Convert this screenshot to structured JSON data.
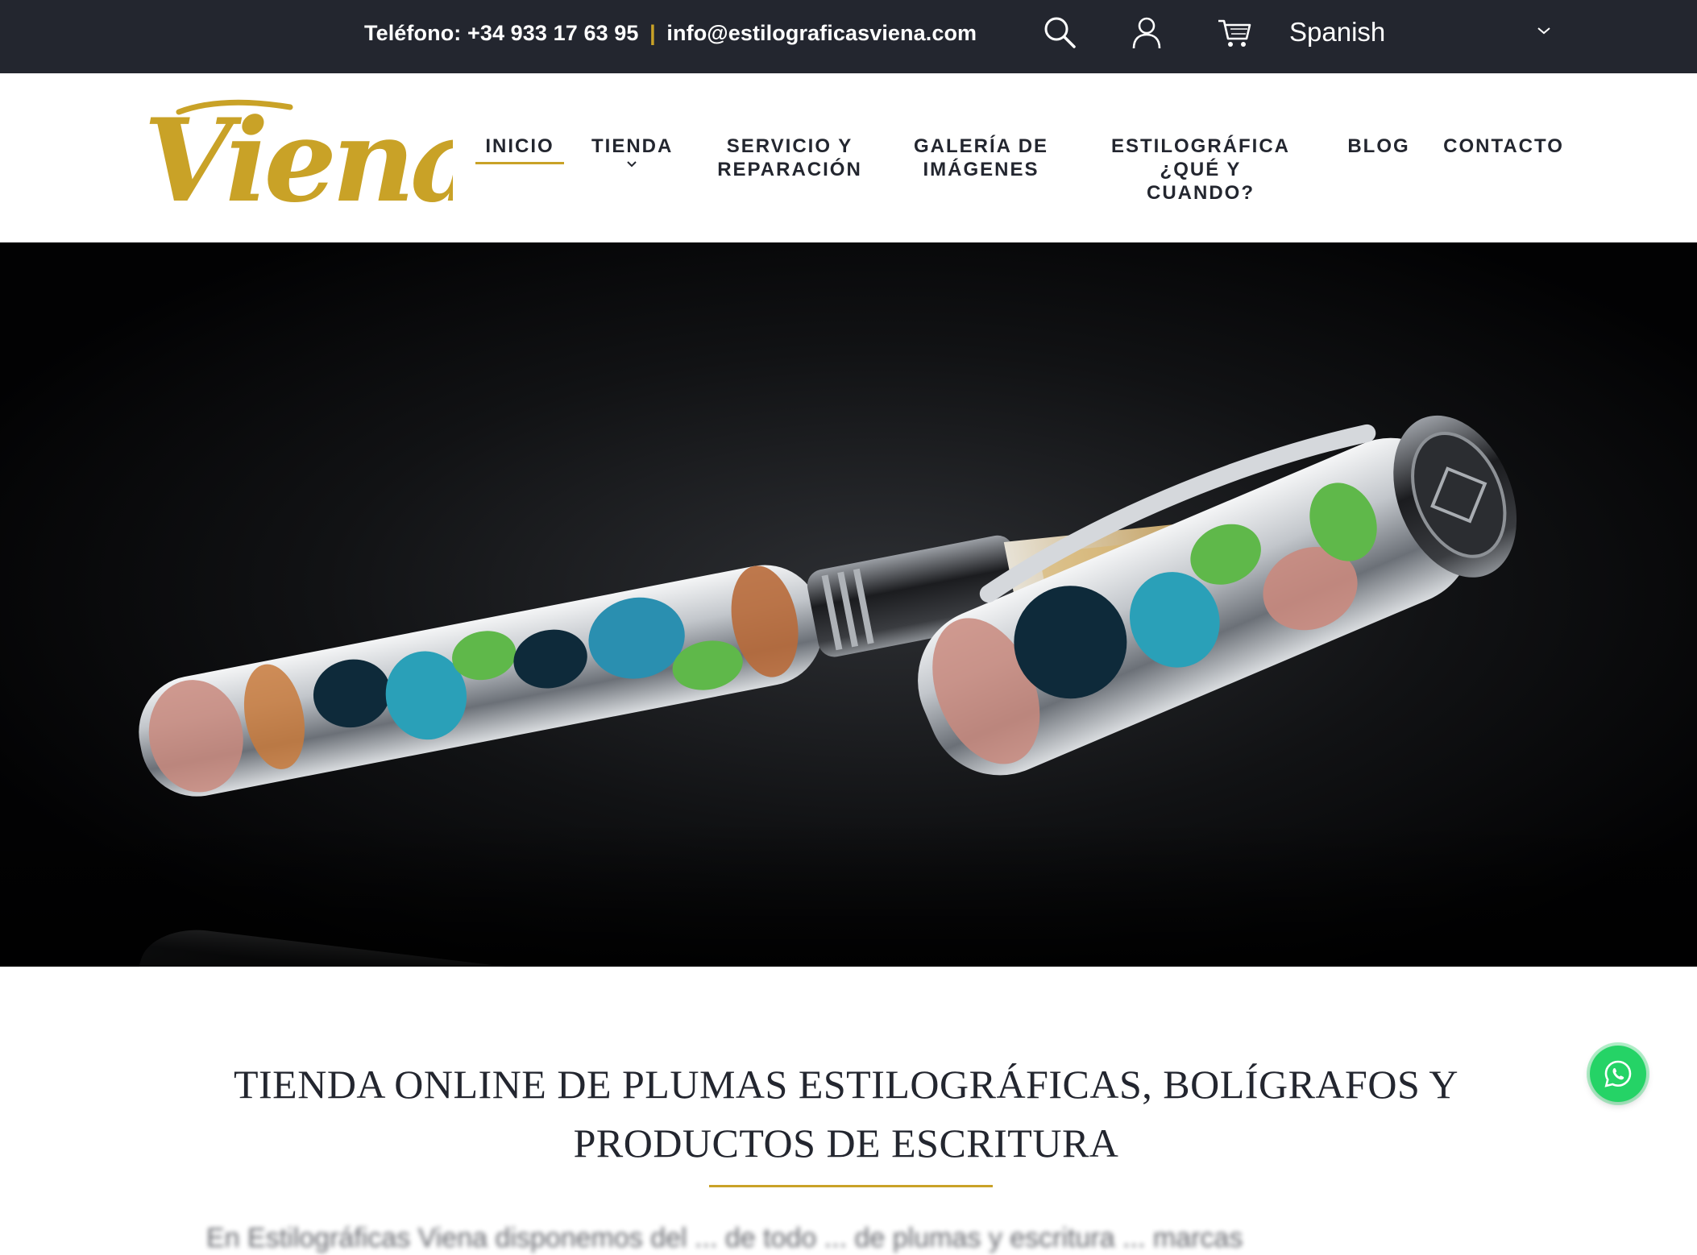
{
  "topbar": {
    "phone_label": "Teléfono: +34 933 17 63 95",
    "separator": "|",
    "email": "info@estilograficasviena.com",
    "icons": [
      "search-icon",
      "user-icon",
      "cart-icon"
    ],
    "language": "Spanish"
  },
  "brand": {
    "logo_text": "Viena",
    "logo_color": "#c9a227"
  },
  "menu": [
    {
      "label": "INICIO",
      "active": true
    },
    {
      "label": "TIENDA",
      "has_dropdown": true
    },
    {
      "label_line1": "SERVICIO Y",
      "label_line2": "REPARACIÓN"
    },
    {
      "label_line1": "GALERÍA DE",
      "label_line2": "IMÁGENES"
    },
    {
      "label_line1": "ESTILOGRÁFICA",
      "label_line2": "¿QUÉ Y CUANDO?"
    },
    {
      "label": "BLOG"
    },
    {
      "label": "CONTACTO"
    }
  ],
  "hero": {
    "image": "visconti-fountain-pen-photo"
  },
  "content": {
    "headline_line1": "TIENDA ONLINE DE PLUMAS ESTILOGRÁFICAS, BOLÍGRAFOS Y",
    "headline_line2": "PRODUCTOS DE ESCRITURA",
    "intro_partial": "En Estilográficas Viena disponemos del ... de todo ... de plumas y escritura ... marcas"
  },
  "floating": {
    "whatsapp_icon": "whatsapp-icon"
  },
  "colors": {
    "topbar_bg": "#23262f",
    "accent_gold": "#c9a227",
    "text_dark": "#23262f",
    "whatsapp_green": "#25d366"
  }
}
